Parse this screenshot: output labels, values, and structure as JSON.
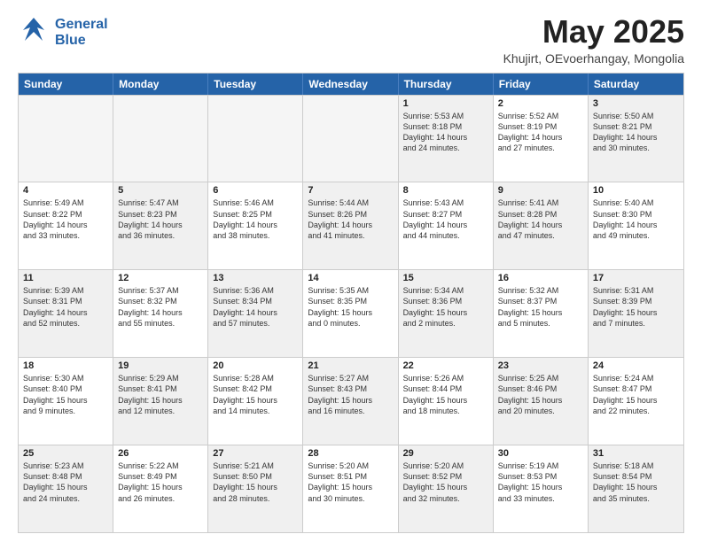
{
  "logo": {
    "line1": "General",
    "line2": "Blue"
  },
  "title": "May 2025",
  "subtitle": "Khujirt, OEvoerhangay, Mongolia",
  "header_days": [
    "Sunday",
    "Monday",
    "Tuesday",
    "Wednesday",
    "Thursday",
    "Friday",
    "Saturday"
  ],
  "rows": [
    [
      {
        "day": "",
        "info": "",
        "shaded": true
      },
      {
        "day": "",
        "info": "",
        "shaded": false
      },
      {
        "day": "",
        "info": "",
        "shaded": true
      },
      {
        "day": "",
        "info": "",
        "shaded": false
      },
      {
        "day": "1",
        "info": "Sunrise: 5:53 AM\nSunset: 8:18 PM\nDaylight: 14 hours\nand 24 minutes.",
        "shaded": true
      },
      {
        "day": "2",
        "info": "Sunrise: 5:52 AM\nSunset: 8:19 PM\nDaylight: 14 hours\nand 27 minutes.",
        "shaded": false
      },
      {
        "day": "3",
        "info": "Sunrise: 5:50 AM\nSunset: 8:21 PM\nDaylight: 14 hours\nand 30 minutes.",
        "shaded": true
      }
    ],
    [
      {
        "day": "4",
        "info": "Sunrise: 5:49 AM\nSunset: 8:22 PM\nDaylight: 14 hours\nand 33 minutes.",
        "shaded": false
      },
      {
        "day": "5",
        "info": "Sunrise: 5:47 AM\nSunset: 8:23 PM\nDaylight: 14 hours\nand 36 minutes.",
        "shaded": true
      },
      {
        "day": "6",
        "info": "Sunrise: 5:46 AM\nSunset: 8:25 PM\nDaylight: 14 hours\nand 38 minutes.",
        "shaded": false
      },
      {
        "day": "7",
        "info": "Sunrise: 5:44 AM\nSunset: 8:26 PM\nDaylight: 14 hours\nand 41 minutes.",
        "shaded": true
      },
      {
        "day": "8",
        "info": "Sunrise: 5:43 AM\nSunset: 8:27 PM\nDaylight: 14 hours\nand 44 minutes.",
        "shaded": false
      },
      {
        "day": "9",
        "info": "Sunrise: 5:41 AM\nSunset: 8:28 PM\nDaylight: 14 hours\nand 47 minutes.",
        "shaded": true
      },
      {
        "day": "10",
        "info": "Sunrise: 5:40 AM\nSunset: 8:30 PM\nDaylight: 14 hours\nand 49 minutes.",
        "shaded": false
      }
    ],
    [
      {
        "day": "11",
        "info": "Sunrise: 5:39 AM\nSunset: 8:31 PM\nDaylight: 14 hours\nand 52 minutes.",
        "shaded": true
      },
      {
        "day": "12",
        "info": "Sunrise: 5:37 AM\nSunset: 8:32 PM\nDaylight: 14 hours\nand 55 minutes.",
        "shaded": false
      },
      {
        "day": "13",
        "info": "Sunrise: 5:36 AM\nSunset: 8:34 PM\nDaylight: 14 hours\nand 57 minutes.",
        "shaded": true
      },
      {
        "day": "14",
        "info": "Sunrise: 5:35 AM\nSunset: 8:35 PM\nDaylight: 15 hours\nand 0 minutes.",
        "shaded": false
      },
      {
        "day": "15",
        "info": "Sunrise: 5:34 AM\nSunset: 8:36 PM\nDaylight: 15 hours\nand 2 minutes.",
        "shaded": true
      },
      {
        "day": "16",
        "info": "Sunrise: 5:32 AM\nSunset: 8:37 PM\nDaylight: 15 hours\nand 5 minutes.",
        "shaded": false
      },
      {
        "day": "17",
        "info": "Sunrise: 5:31 AM\nSunset: 8:39 PM\nDaylight: 15 hours\nand 7 minutes.",
        "shaded": true
      }
    ],
    [
      {
        "day": "18",
        "info": "Sunrise: 5:30 AM\nSunset: 8:40 PM\nDaylight: 15 hours\nand 9 minutes.",
        "shaded": false
      },
      {
        "day": "19",
        "info": "Sunrise: 5:29 AM\nSunset: 8:41 PM\nDaylight: 15 hours\nand 12 minutes.",
        "shaded": true
      },
      {
        "day": "20",
        "info": "Sunrise: 5:28 AM\nSunset: 8:42 PM\nDaylight: 15 hours\nand 14 minutes.",
        "shaded": false
      },
      {
        "day": "21",
        "info": "Sunrise: 5:27 AM\nSunset: 8:43 PM\nDaylight: 15 hours\nand 16 minutes.",
        "shaded": true
      },
      {
        "day": "22",
        "info": "Sunrise: 5:26 AM\nSunset: 8:44 PM\nDaylight: 15 hours\nand 18 minutes.",
        "shaded": false
      },
      {
        "day": "23",
        "info": "Sunrise: 5:25 AM\nSunset: 8:46 PM\nDaylight: 15 hours\nand 20 minutes.",
        "shaded": true
      },
      {
        "day": "24",
        "info": "Sunrise: 5:24 AM\nSunset: 8:47 PM\nDaylight: 15 hours\nand 22 minutes.",
        "shaded": false
      }
    ],
    [
      {
        "day": "25",
        "info": "Sunrise: 5:23 AM\nSunset: 8:48 PM\nDaylight: 15 hours\nand 24 minutes.",
        "shaded": true
      },
      {
        "day": "26",
        "info": "Sunrise: 5:22 AM\nSunset: 8:49 PM\nDaylight: 15 hours\nand 26 minutes.",
        "shaded": false
      },
      {
        "day": "27",
        "info": "Sunrise: 5:21 AM\nSunset: 8:50 PM\nDaylight: 15 hours\nand 28 minutes.",
        "shaded": true
      },
      {
        "day": "28",
        "info": "Sunrise: 5:20 AM\nSunset: 8:51 PM\nDaylight: 15 hours\nand 30 minutes.",
        "shaded": false
      },
      {
        "day": "29",
        "info": "Sunrise: 5:20 AM\nSunset: 8:52 PM\nDaylight: 15 hours\nand 32 minutes.",
        "shaded": true
      },
      {
        "day": "30",
        "info": "Sunrise: 5:19 AM\nSunset: 8:53 PM\nDaylight: 15 hours\nand 33 minutes.",
        "shaded": false
      },
      {
        "day": "31",
        "info": "Sunrise: 5:18 AM\nSunset: 8:54 PM\nDaylight: 15 hours\nand 35 minutes.",
        "shaded": true
      }
    ]
  ]
}
